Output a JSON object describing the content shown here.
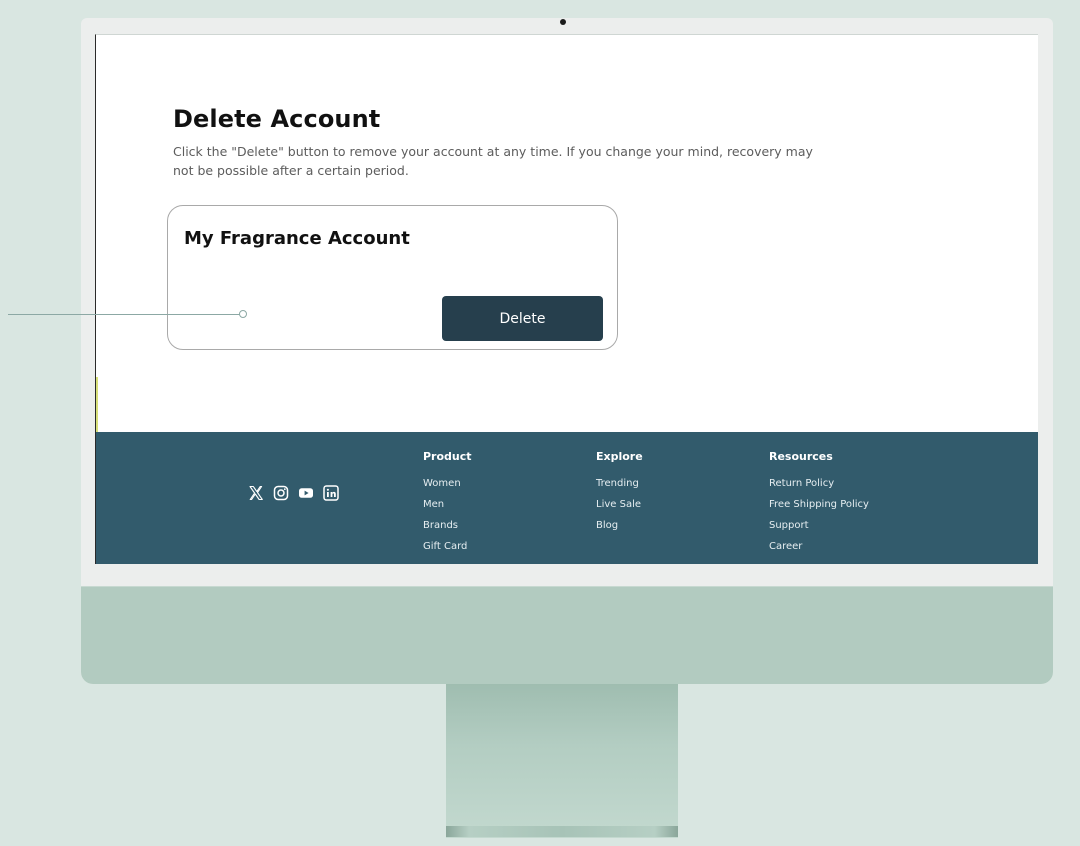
{
  "account_page": {
    "title": "Delete Account",
    "description": "Click the \"Delete\" button to remove your account at any time. If you change your mind, recovery may not be possible after a certain period.",
    "card": {
      "title": "My Fragrance Account",
      "delete_label": "Delete"
    }
  },
  "footer": {
    "social_icons": [
      "x-icon",
      "instagram-icon",
      "youtube-icon",
      "linkedin-icon"
    ],
    "columns": [
      {
        "heading": "Product",
        "links": [
          "Women",
          "Men",
          "Brands",
          "Gift Card"
        ]
      },
      {
        "heading": "Explore",
        "links": [
          "Trending",
          "Live Sale",
          "Blog"
        ]
      },
      {
        "heading": "Resources",
        "links": [
          "Return Policy",
          "Free Shipping Policy",
          "Support",
          "Career"
        ]
      }
    ]
  },
  "colors": {
    "background": "#d9e6e1",
    "monitor_chin": "#b2cbc0",
    "button": "#263f4d",
    "footer": "#325b6c"
  }
}
